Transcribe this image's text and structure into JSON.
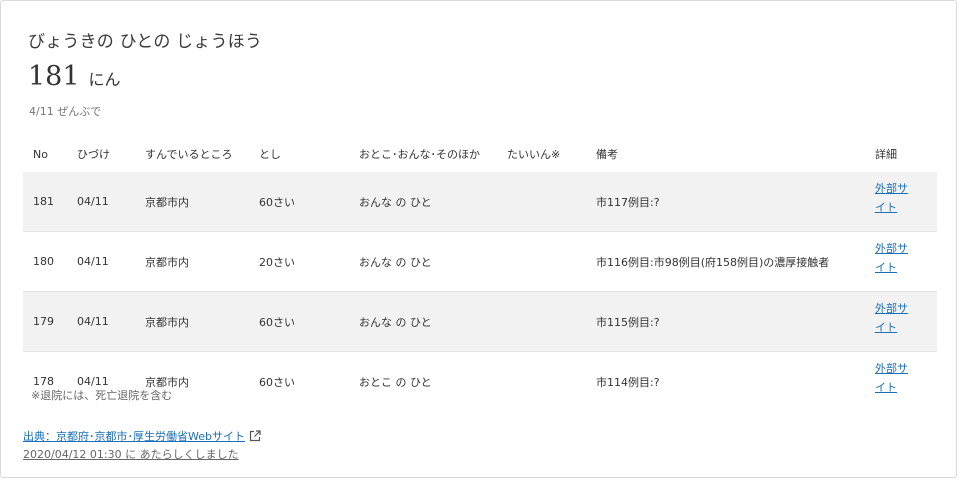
{
  "header": {
    "title": "びょうきの ひとの じょうほう",
    "count": "181",
    "count_unit": "にん",
    "subtitle": "4/11 ぜんぶで"
  },
  "table": {
    "columns": [
      "No",
      "ひづけ",
      "すんでいるところ",
      "とし",
      "おとこ･おんな･そのほか",
      "たいいん※",
      "備考",
      "詳細"
    ],
    "rows": [
      {
        "no": "181",
        "date": "04/11",
        "residence": "京都市内",
        "age": "60さい",
        "sex": "おんな の ひと",
        "discharged": "",
        "note": "市117例目:?",
        "detail_line1": "外部サ",
        "detail_line2": "イト"
      },
      {
        "no": "180",
        "date": "04/11",
        "residence": "京都市内",
        "age": "20さい",
        "sex": "おんな の ひと",
        "discharged": "",
        "note": "市116例目:市98例目(府158例目)の濃厚接触者",
        "detail_line1": "外部サ",
        "detail_line2": "イト"
      },
      {
        "no": "179",
        "date": "04/11",
        "residence": "京都市内",
        "age": "60さい",
        "sex": "おんな の ひと",
        "discharged": "",
        "note": "市115例目:?",
        "detail_line1": "外部サ",
        "detail_line2": "イト"
      },
      {
        "no": "178",
        "date": "04/11",
        "residence": "京都市内",
        "age": "60さい",
        "sex": "おとこ の ひと",
        "discharged": "",
        "note": "市114例目:?",
        "detail_line1": "外部サ",
        "detail_line2": "イト"
      }
    ]
  },
  "footnote": "※退院には、死亡退院を含む",
  "source": {
    "label": "出典：京都府･京都市･厚生労働省Webサイト",
    "icon": "external-link-icon"
  },
  "updated": "2020/04/12 01:30 に あたらしくしました",
  "colors": {
    "link": "#1a6fb8",
    "stripe": "#f2f2f2",
    "border": "#d9d9d9"
  }
}
